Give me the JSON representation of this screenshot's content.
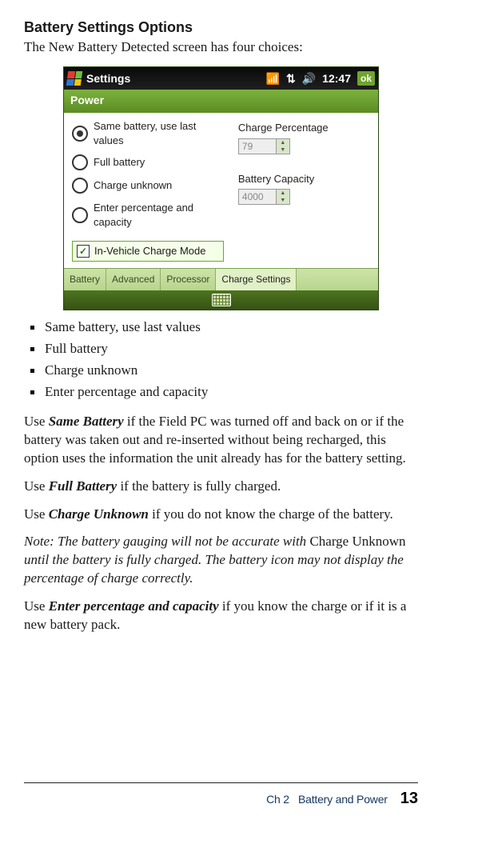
{
  "heading": "Battery Settings Options",
  "intro": "The New Battery Detected screen has four choices:",
  "screenshot": {
    "titlebar_text": "Settings",
    "clock": "12:47",
    "ok": "ok",
    "subheader": "Power",
    "radios": [
      {
        "label": "Same battery, use last values",
        "checked": true
      },
      {
        "label": "Full battery",
        "checked": false
      },
      {
        "label": "Charge unknown",
        "checked": false
      },
      {
        "label": "Enter percentage and capacity",
        "checked": false
      }
    ],
    "checkbox_label": "In-Vehicle Charge Mode",
    "checkbox_checked": true,
    "right": {
      "charge_label": "Charge Percentage",
      "charge_value": "79",
      "capacity_label": "Battery Capacity",
      "capacity_value": "4000"
    },
    "tabs": [
      "Battery",
      "Advanced",
      "Processor",
      "Charge Settings"
    ],
    "active_tab_index": 3
  },
  "bullets": [
    "Same battery, use last values",
    "Full battery",
    "Charge unknown",
    "Enter percentage and capacity"
  ],
  "para_same": {
    "lead": "Use ",
    "term": "Same Battery",
    "rest": " if the Field PC was turned off and back on or if the battery was taken out and re-inserted without being recharged, this option uses the information the unit already has for the battery setting."
  },
  "para_full": {
    "lead": "Use ",
    "term": "Full Battery",
    "rest": " if the battery is fully charged."
  },
  "para_unknown": {
    "lead": "Use ",
    "term": "Charge Unknown",
    "rest": " if you do not know the charge of the battery."
  },
  "note": {
    "pre": "Note: The battery gauging will not be accurate with ",
    "upright": "Charge Unknown",
    "post": " until the battery is fully charged. The battery icon may not display the percentage of charge correctly."
  },
  "para_enter": {
    "lead": "Use ",
    "term": "Enter percentage and capacity",
    "rest": " if you know the charge or if it is a new battery pack."
  },
  "footer": {
    "chapter": "Ch 2",
    "title": "Battery and Power",
    "page": "13"
  }
}
